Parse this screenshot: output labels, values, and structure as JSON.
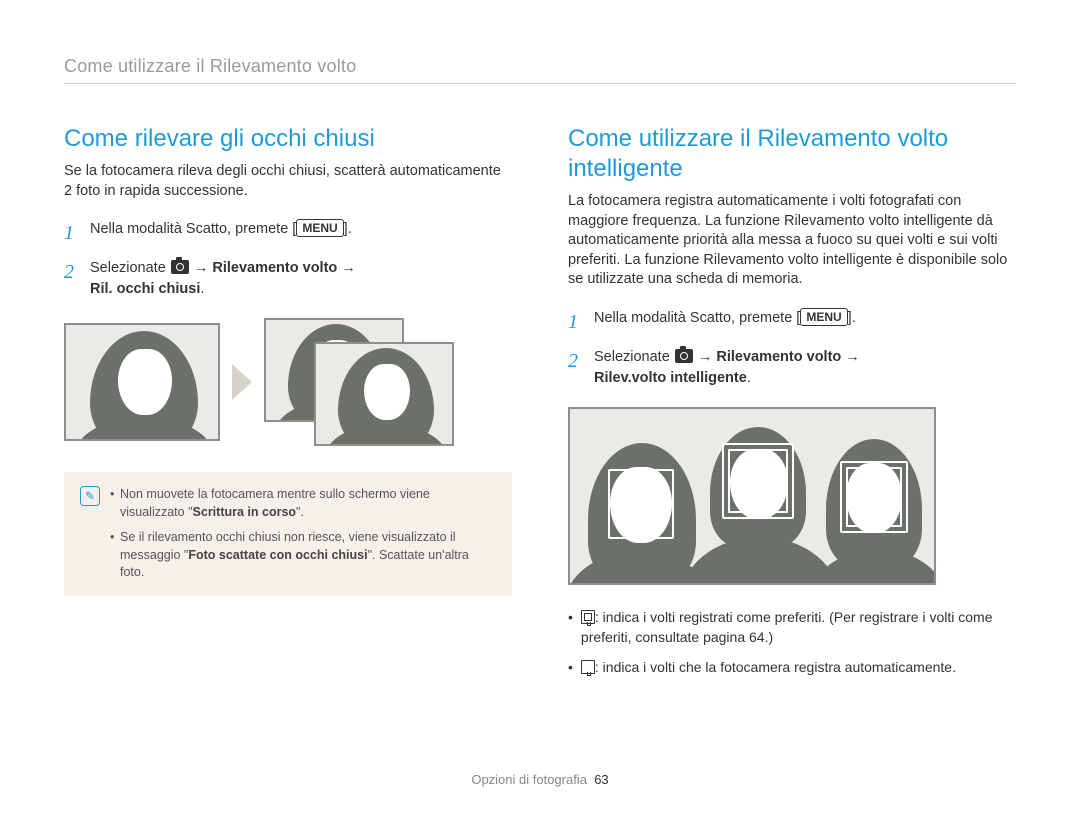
{
  "header": {
    "breadcrumb": "Come utilizzare il Rilevamento volto"
  },
  "left": {
    "title": "Come rilevare gli occhi chiusi",
    "intro": "Se la fotocamera rileva degli occhi chiusi, scatterà automaticamente 2 foto in rapida successione.",
    "step1_a": "Nella modalità Scatto, premete [",
    "step1_menu": "MENU",
    "step1_b": "].",
    "step2_a": "Selezionate ",
    "step2_b": " → ",
    "step2_bold1": "Rilevamento volto",
    "step2_c": " → ",
    "step2_bold2": "Ril. occhi chiusi",
    "step2_d": ".",
    "note1_a": "Non muovete la fotocamera mentre sullo schermo viene visualizzato \"",
    "note1_bold": "Scrittura in corso",
    "note1_b": "\".",
    "note2_a": "Se il rilevamento occhi chiusi non riesce, viene visualizzato il messaggio \"",
    "note2_bold": "Foto scattate con occhi chiusi",
    "note2_b": "\". Scattate un'altra foto."
  },
  "right": {
    "title": "Come utilizzare il Rilevamento volto intelligente",
    "intro": "La fotocamera registra automaticamente i volti fotografati con maggiore frequenza. La funzione Rilevamento volto intelligente dà automaticamente priorità alla messa a fuoco su quei volti e sui volti preferiti. La funzione Rilevamento volto intelligente è disponibile solo se utilizzate una scheda di memoria.",
    "step1_a": "Nella modalità Scatto, premete [",
    "step1_menu": "MENU",
    "step1_b": "].",
    "step2_a": "Selezionate ",
    "step2_b": " → ",
    "step2_bold1": "Rilevamento volto",
    "step2_c": " → ",
    "step2_bold2": "Rilev.volto intelligente",
    "step2_d": ".",
    "bullet1": ": indica i volti registrati come preferiti. (Per registrare i volti come preferiti, consultate pagina 64.)",
    "bullet2": ": indica i volti che la fotocamera registra automaticamente."
  },
  "footer": {
    "section": "Opzioni di fotografia",
    "page": "63"
  }
}
